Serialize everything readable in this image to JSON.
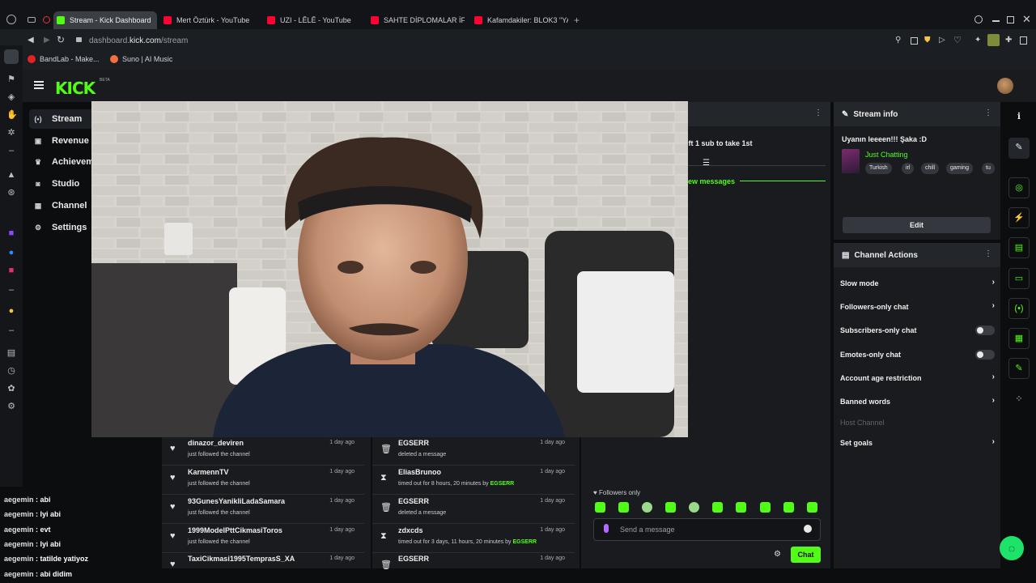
{
  "browser": {
    "tabs": [
      {
        "label": "Stream - Kick Dashboard",
        "type": "kick"
      },
      {
        "label": "Mert Öztürk - YouTube",
        "type": "yt"
      },
      {
        "label": "UZI - LÊLÊ - YouTube",
        "type": "yt"
      },
      {
        "label": "SAHTE DİPLOMALAR İFŞ",
        "type": "yt"
      },
      {
        "label": "Kafamdakiler: BLOK3 \"YA",
        "type": "yt"
      }
    ],
    "url_prefix": "dashboard.",
    "url_domain": "kick.com",
    "url_path": "/stream",
    "bookmarks": [
      "BandLab - Make...",
      "Suno | AI Music"
    ]
  },
  "brand": {
    "logo": "KICK",
    "beta": "BETA"
  },
  "nav": {
    "items": [
      {
        "label": "Stream",
        "icon": "broadcast-icon"
      },
      {
        "label": "Revenue",
        "icon": "revenue-icon"
      },
      {
        "label": "Achievem",
        "icon": "trophy-icon"
      },
      {
        "label": "Studio",
        "icon": "studio-icon"
      },
      {
        "label": "Channel",
        "icon": "channel-icon"
      },
      {
        "label": "Settings",
        "icon": "gear-icon"
      }
    ]
  },
  "chat_panel": {
    "gift_text": "ift 1 sub to take 1st",
    "new_messages": "ew messages",
    "followers_only": "Followers only",
    "placeholder": "Send a message",
    "chat_button": "Chat"
  },
  "stream_info": {
    "title": "Stream info",
    "stream_title": "Uyanın leeeen!!! Şaka :D",
    "category": "Just Chatting",
    "tags": [
      "Turkish",
      "irl",
      "chill",
      "gaming",
      "tu"
    ],
    "edit": "Edit"
  },
  "channel_actions": {
    "title": "Channel Actions",
    "rows": [
      {
        "label": "Slow mode",
        "control": "chevron"
      },
      {
        "label": "Followers-only chat",
        "control": "chevron"
      },
      {
        "label": "Subscribers-only chat",
        "control": "toggle"
      },
      {
        "label": "Emotes-only chat",
        "control": "toggle"
      },
      {
        "label": "Account age restriction",
        "control": "chevron"
      },
      {
        "label": "Banned words",
        "control": "chevron"
      },
      {
        "label": "Host Channel",
        "control": "none"
      },
      {
        "label": "Set goals",
        "control": "chevron"
      }
    ]
  },
  "activity_feed": [
    {
      "name": "dinazor_deviren",
      "sub": "just followed the channel",
      "time": "1 day ago"
    },
    {
      "name": "KarmennTV",
      "sub": "just followed the channel",
      "time": "1 day ago"
    },
    {
      "name": "93GunesYanikliLadaSamara",
      "sub": "just followed the channel",
      "time": "1 day ago"
    },
    {
      "name": "1999ModelPttCikmasiToros",
      "sub": "just followed the channel",
      "time": "1 day ago"
    },
    {
      "name": "TaxiCikmasi1995TemprasS_XA",
      "sub": "",
      "time": "1 day ago"
    }
  ],
  "mod_log": [
    {
      "name": "EGSERR",
      "sub": "deleted a message",
      "by": "",
      "time": "1 day ago",
      "icon": "trash-icon"
    },
    {
      "name": "EliasBrunoo",
      "sub": "timed out for 8 hours, 20 minutes by",
      "by": "EGSERR",
      "time": "1 day ago",
      "icon": "hourglass-icon"
    },
    {
      "name": "EGSERR",
      "sub": "deleted a message",
      "by": "",
      "time": "1 day ago",
      "icon": "trash-icon"
    },
    {
      "name": "zdxcds",
      "sub": "timed out for 3 days, 11 hours, 20 minutes by",
      "by": "EGSERR",
      "time": "1 day ago",
      "icon": "hourglass-icon"
    },
    {
      "name": "EGSERR",
      "sub": "",
      "by": "",
      "time": "1 day ago",
      "icon": "trash-icon"
    }
  ],
  "overlay_chat": [
    {
      "user": "aegemin",
      "msg": "abi"
    },
    {
      "user": "aegemin",
      "msg": "Iyi abi"
    },
    {
      "user": "aegemin",
      "msg": "evt"
    },
    {
      "user": "aegemin",
      "msg": "Iyi abi"
    },
    {
      "user": "aegemin",
      "msg": "tatilde yatiyoz"
    },
    {
      "user": "aegemin",
      "msg": "abi didim"
    }
  ],
  "colors": {
    "accent": "#53fc18",
    "panel": "#191b1f",
    "background": "#0b0d0f"
  }
}
